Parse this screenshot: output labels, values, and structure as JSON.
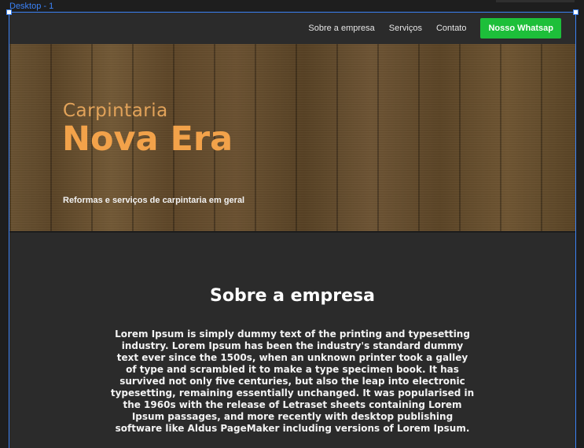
{
  "editor": {
    "frame_label": "Desktop - 1",
    "selection_color": "#3b82f6"
  },
  "nav": {
    "links": [
      "Sobre a empresa",
      "Serviços",
      "Contato"
    ],
    "cta_label": "Nosso Whatsap",
    "cta_color": "#1dbf3a"
  },
  "hero": {
    "kicker": "Carpintaria",
    "title": "Nova Era",
    "subtitle": "Reformas e serviços de carpintaria em geral",
    "title_color": "#f2a24a"
  },
  "about": {
    "title": "Sobre a empresa",
    "body": "Lorem Ipsum is simply dummy text of the printing and typesetting industry. Lorem Ipsum has been the industry's standard dummy text ever since the 1500s, when an unknown printer took a galley of type and scrambled it to make a type specimen book. It has survived not only five centuries, but also the leap into electronic typesetting, remaining essentially unchanged. It was popularised in the 1960s with the release of Letraset sheets containing Lorem Ipsum passages, and more recently with desktop publishing software like Aldus PageMaker including versions of Lorem Ipsum."
  }
}
